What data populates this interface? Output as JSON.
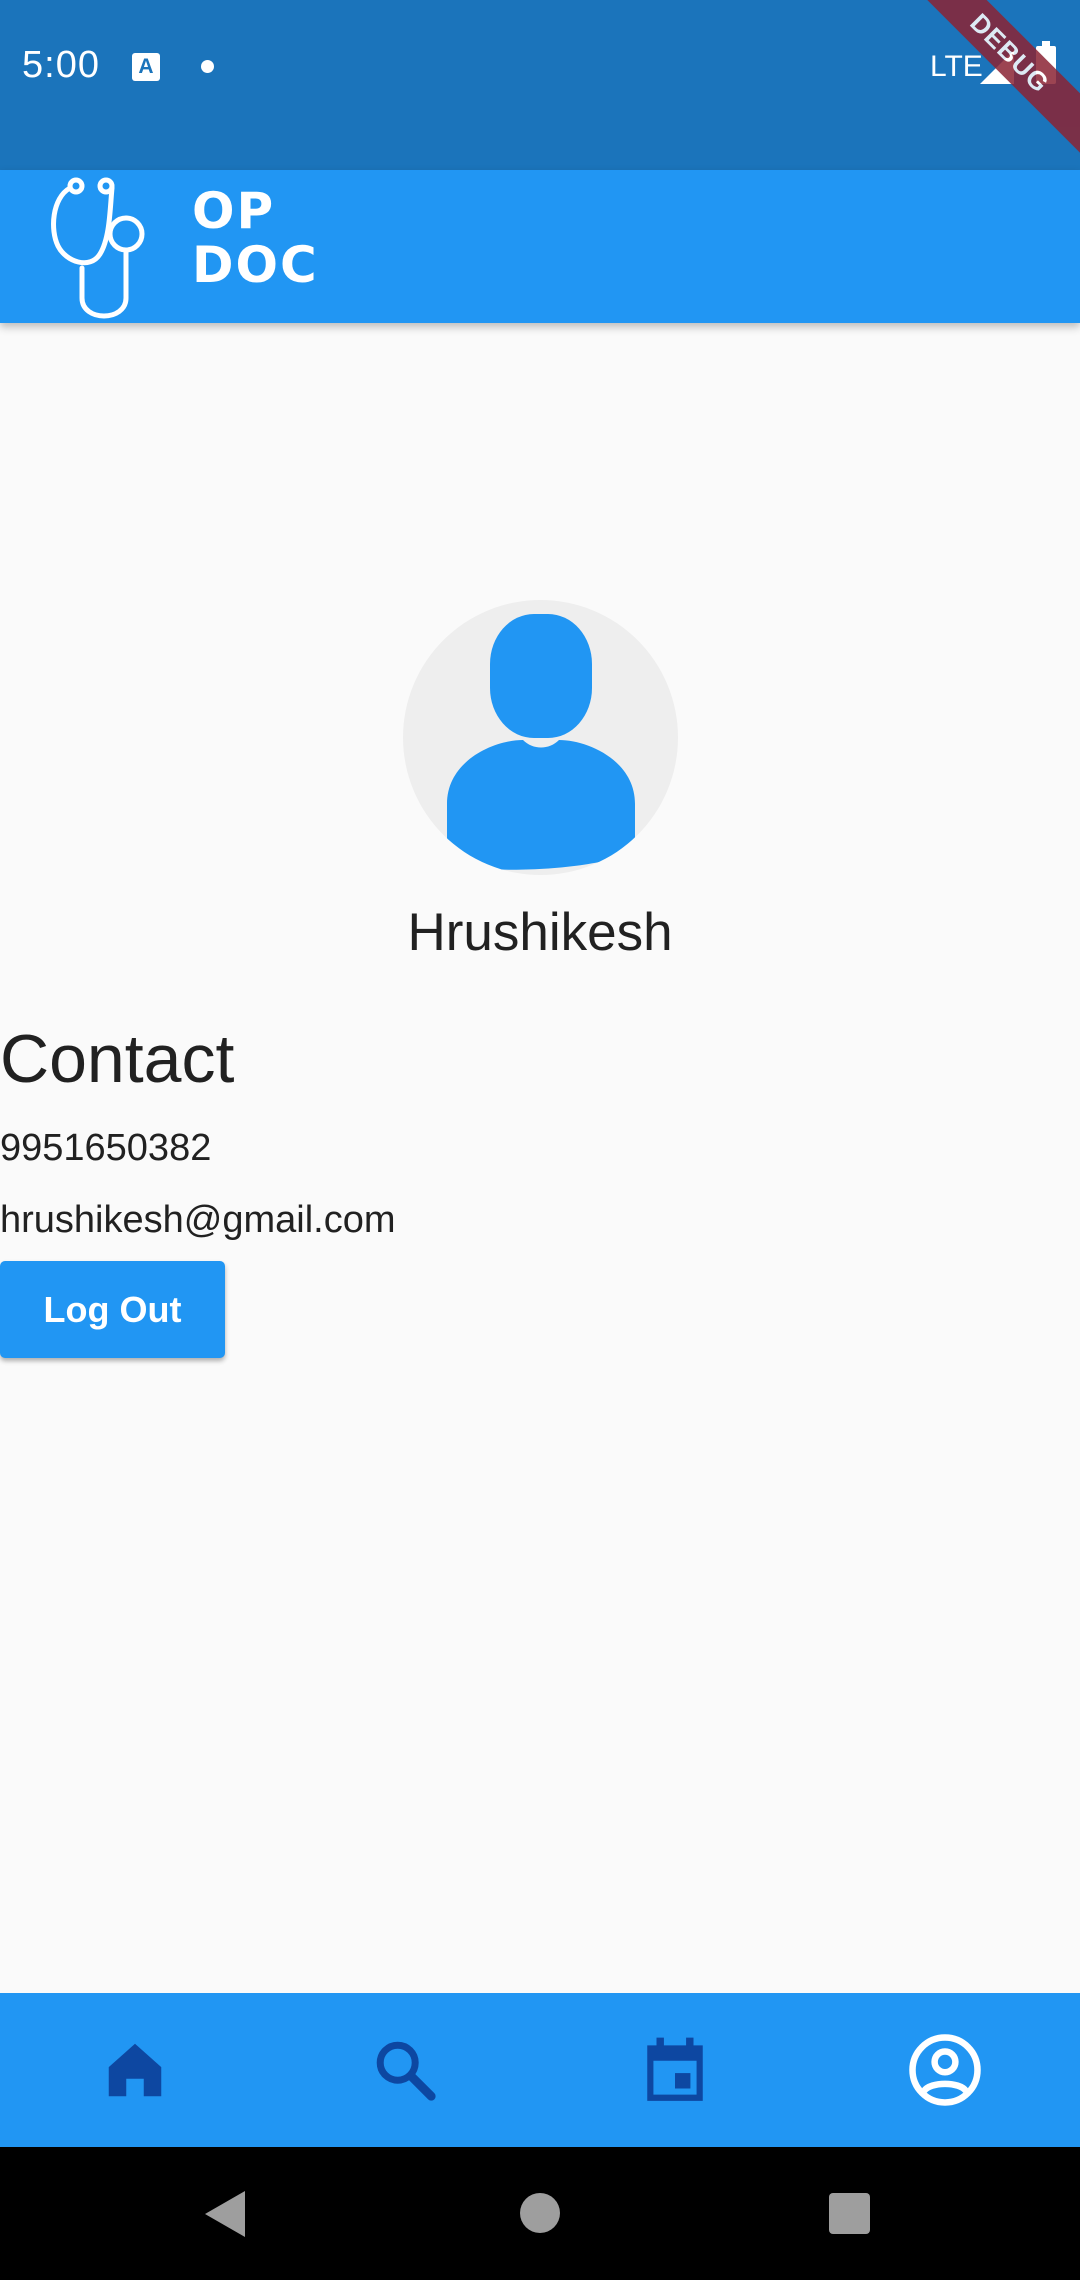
{
  "status_bar": {
    "time": "5:00",
    "notification_icon": "A",
    "network": "LTE"
  },
  "debug_banner": "DEBUG",
  "app_bar": {
    "logo_line1": "OP",
    "logo_line2": "DOC"
  },
  "profile": {
    "name": "Hrushikesh"
  },
  "contact": {
    "heading": "Contact",
    "phone": "9951650382",
    "email": "hrushikesh@gmail.com"
  },
  "actions": {
    "logout_label": "Log Out"
  },
  "bottom_nav": {
    "items": [
      {
        "icon": "home-icon"
      },
      {
        "icon": "search-icon"
      },
      {
        "icon": "calendar-icon"
      },
      {
        "icon": "account-circle-icon",
        "selected": true
      }
    ]
  },
  "colors": {
    "primary": "#2196f3",
    "status_bar": "#1b74bb",
    "nav_icon_inactive": "#0d47a1",
    "nav_icon_active": "#ffffff",
    "background": "#fafafa"
  }
}
